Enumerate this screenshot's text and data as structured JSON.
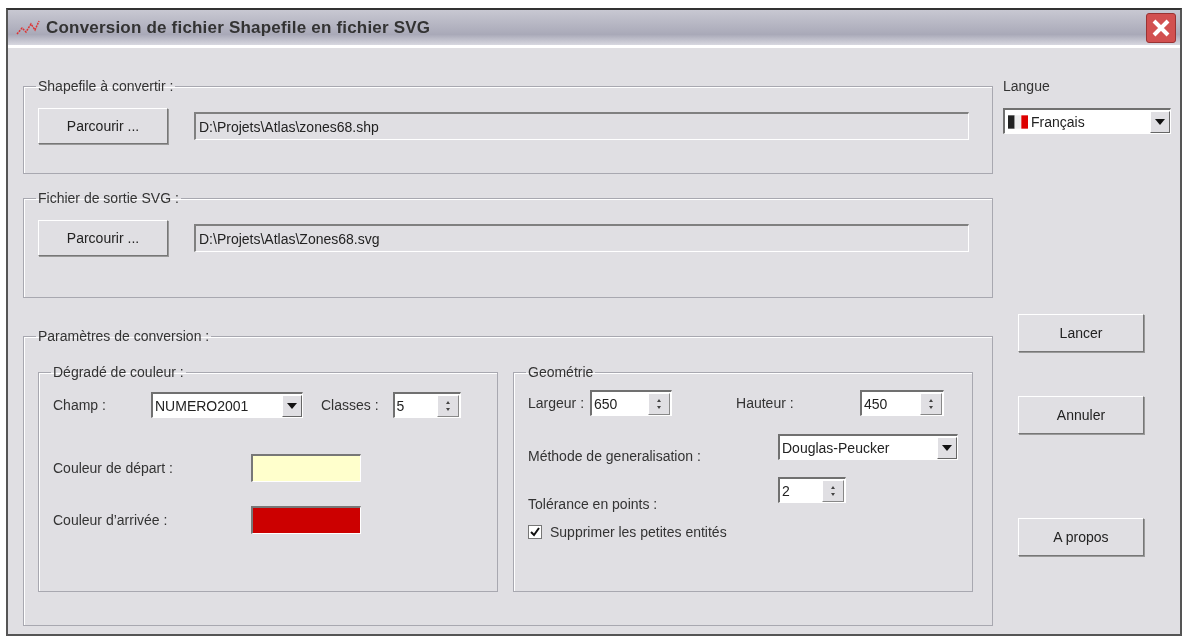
{
  "window": {
    "title": "Conversion de fichier Shapefile en fichier SVG"
  },
  "shapefile_group": {
    "legend": "Shapefile à convertir :",
    "browse_button": "Parcourir ...",
    "path": "D:\\Projets\\Atlas\\zones68.shp"
  },
  "output_group": {
    "legend": "Fichier de sortie SVG :",
    "browse_button": "Parcourir ...",
    "path": "D:\\Projets\\Atlas\\Zones68.svg"
  },
  "language": {
    "label": "Langue",
    "value": "Français"
  },
  "conversion": {
    "legend": "Paramètres de conversion :",
    "gradient": {
      "legend": "Dégradé de couleur :",
      "field_label": "Champ :",
      "field_value": "NUMERO2001",
      "classes_label": "Classes :",
      "classes_value": "5",
      "color_stops": [
        {
          "label": "Couleur de départ :",
          "color": "#ffffcc"
        },
        {
          "label": "Couleur d’arrivée :",
          "color": "#cc0000"
        }
      ]
    },
    "geometry": {
      "legend": "Geométrie",
      "width_label": "Largeur :",
      "width_value": "650",
      "height_label": "Hauteur :",
      "height_value": "450",
      "method_label": "Méthode de generalisation :",
      "method_value": "Douglas-Peucker",
      "tolerance_label": "Tolérance en points :",
      "tolerance_value": "2",
      "remove_small": {
        "label": "Supprimer les petites entités",
        "checked": true
      }
    }
  },
  "buttons": [
    "Lancer",
    "Annuler",
    "A propos"
  ]
}
